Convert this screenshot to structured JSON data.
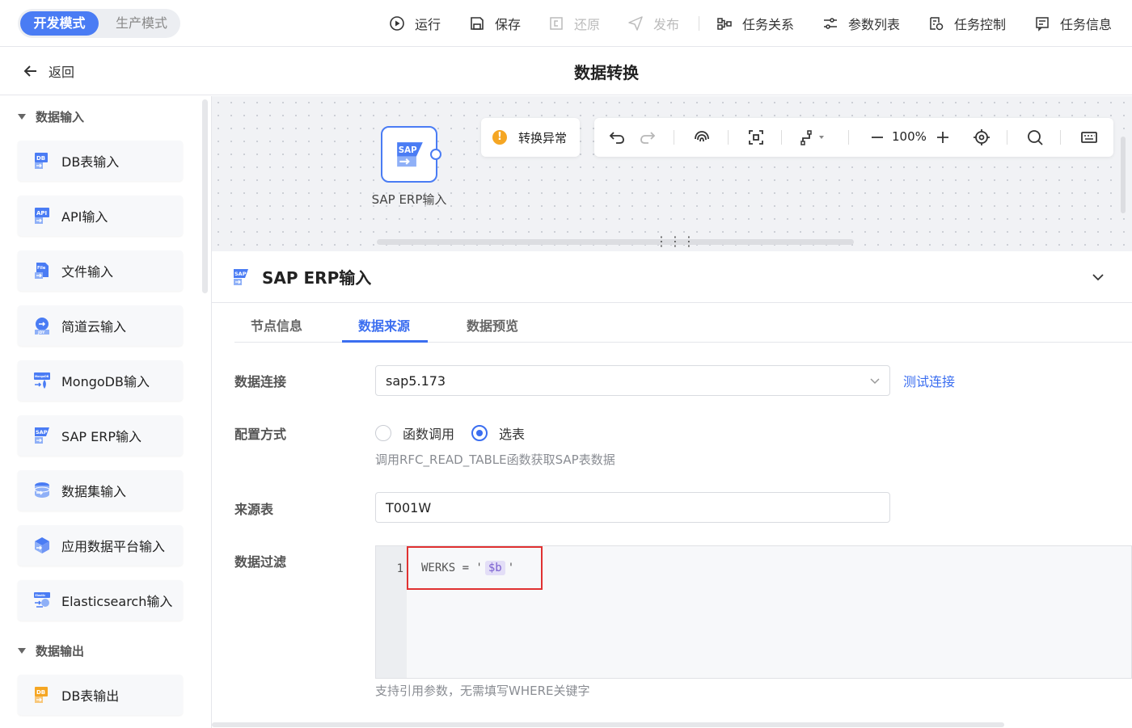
{
  "colors": {
    "accent": "#3b6ef0",
    "highlight": "#e03131",
    "warning": "#f5a623"
  },
  "mode": {
    "dev": "开发模式",
    "prod": "生产模式"
  },
  "toolbar": {
    "run": "运行",
    "save": "保存",
    "revert": "还原",
    "publish": "发布",
    "relation": "任务关系",
    "params": "参数列表",
    "control": "任务控制",
    "info": "任务信息"
  },
  "header": {
    "back": "返回",
    "title": "数据转换"
  },
  "sidebar": {
    "input_group": "数据输入",
    "items": [
      {
        "label": "DB表输入",
        "icon": "db-icon",
        "badge": "DB"
      },
      {
        "label": "API输入",
        "icon": "api-icon",
        "badge": "API"
      },
      {
        "label": "文件输入",
        "icon": "file-icon",
        "badge": "File"
      },
      {
        "label": "简道云输入",
        "icon": "jdy-icon",
        "badge": "JDY"
      },
      {
        "label": "MongoDB输入",
        "icon": "mongodb-icon",
        "badge": "MongoDB"
      },
      {
        "label": "SAP ERP输入",
        "icon": "sap-icon",
        "badge": "SAP"
      },
      {
        "label": "数据集输入",
        "icon": "dataset-icon",
        "badge": ""
      },
      {
        "label": "应用数据平台输入",
        "icon": "app-platform-icon",
        "badge": ""
      },
      {
        "label": "Elasticsearch输入",
        "icon": "elasticsearch-icon",
        "badge": "Elastic"
      }
    ],
    "output_group": "数据输出",
    "output_items": [
      {
        "label": "DB表输出",
        "icon": "db-output-icon",
        "badge": "DB"
      }
    ]
  },
  "canvas": {
    "node_label": "SAP ERP输入",
    "node_badge": "SAP",
    "alert": "转换异常",
    "zoom": "100%"
  },
  "panel": {
    "title": "SAP ERP输入",
    "tabs": [
      "节点信息",
      "数据来源",
      "数据预览"
    ],
    "active_tab": "数据来源",
    "connection_label": "数据连接",
    "connection_value": "sap5.173",
    "test_link": "测试连接",
    "config_label": "配置方式",
    "radio_function": "函数调用",
    "radio_table": "选表",
    "config_hint": "调用RFC_READ_TABLE函数获取SAP表数据",
    "source_label": "来源表",
    "source_value": "T001W",
    "filter_label": "数据过滤",
    "line_no": "1",
    "code_prefix": "WERKS = '",
    "code_var": "$b",
    "code_suffix": "'",
    "filter_hint": "支持引用参数，无需填写WHERE关键字"
  }
}
